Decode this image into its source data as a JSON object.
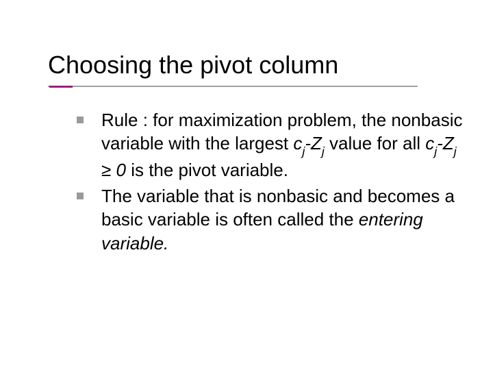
{
  "title": "Choosing the pivot column",
  "bullets": [
    {
      "pre": "Rule : for maximization problem, the nonbasic variable with the largest ",
      "expr1_c": "c",
      "expr1_sub": "j",
      "expr1_dash": "-",
      "expr1_Z": "Z",
      "expr1_sub2": "j",
      "mid": " value for all ",
      "expr2_c": "c",
      "expr2_sub": "j",
      "expr2_dash": "-",
      "expr2_Z": "Z",
      "expr2_sub2": "j",
      "cond_sym": " ≥ ",
      "cond_zero": "0",
      "post": " is the pivot variable."
    },
    {
      "pre": "The variable that is nonbasic and becomes a basic variable is often called the ",
      "em": "entering variable.",
      "post": ""
    }
  ]
}
